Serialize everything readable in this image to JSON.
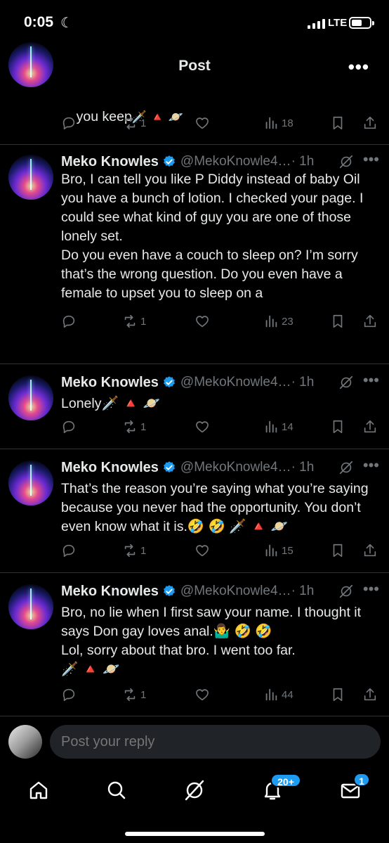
{
  "status_bar": {
    "time": "0:05",
    "network": "LTE"
  },
  "nav": {
    "title": "Post"
  },
  "top_post": {
    "text": "you keep",
    "emojis": "🗡️ 🔺 🪐",
    "retweets": "1",
    "views": "18"
  },
  "posts": [
    {
      "name": "Meko Knowles",
      "handle": "@MekoKnowle4…",
      "time": "· 1h",
      "text": "Bro, I can tell you like P Diddy instead of baby Oil you have a bunch of lotion. I checked your page. I could see what kind of guy you are one of those lonely set.\nDo you even have a couch to sleep on? I’m sorry that’s the wrong question. Do you even have a female to upset you to sleep on a",
      "retweets": "1",
      "views": "23"
    },
    {
      "name": "Meko Knowles",
      "handle": "@MekoKnowle4…",
      "time": "· 1h",
      "text": "Lonely🗡️ 🔺 🪐",
      "retweets": "1",
      "views": "14"
    },
    {
      "name": "Meko Knowles",
      "handle": "@MekoKnowle4…",
      "time": "· 1h",
      "text": "That’s the reason you’re saying what you’re saying because you never had the opportunity. You don’t even know what it is.🤣 🤣 🗡️ 🔺 🪐",
      "retweets": "1",
      "views": "15"
    },
    {
      "name": "Meko Knowles",
      "handle": "@MekoKnowle4…",
      "time": "· 1h",
      "text": "Bro, no lie when I first saw your name. I thought it says Don gay loves anal.🤷‍♂️ 🤣 🤣\nLol, sorry about that bro. I went too far.\n🗡️ 🔺 🪐",
      "retweets": "1",
      "views": "44"
    }
  ],
  "reply": {
    "placeholder": "Post your reply"
  },
  "tabs": {
    "notifications_badge": "20+",
    "messages_badge": "1"
  },
  "colors": {
    "accent": "#1d9bf0",
    "muted": "#71767b",
    "divider": "#2f3336"
  }
}
